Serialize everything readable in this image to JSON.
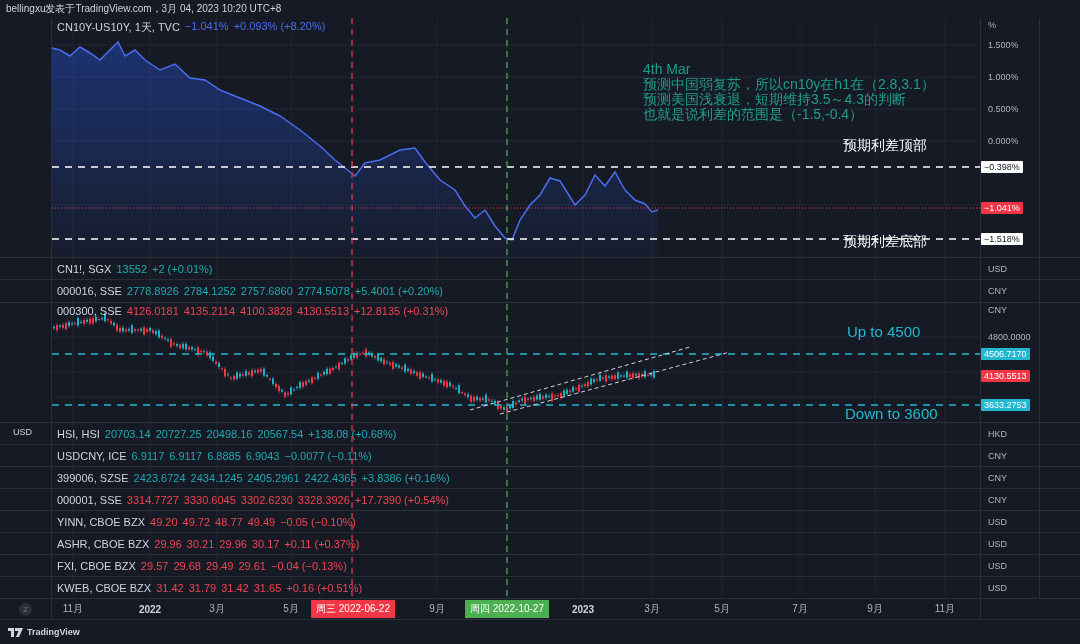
{
  "header": {
    "text": "bellingxu发表于TradingView.com，3月 04, 2023 10:20 UTC+8"
  },
  "panes": [
    {
      "kind": "line",
      "symbol": "CN10Y-US10Y, 1天, TVC",
      "values": [
        "−1.041%",
        "+0.093% (+8.20%)"
      ],
      "color": "#4a6cf0",
      "unit": "%",
      "ticks": [
        "1.500%",
        "1.000%",
        "0.500%",
        "0.000%"
      ],
      "tags": [
        {
          "text": "−0.398%",
          "color": "#ffffff"
        },
        {
          "text": "−1.041%",
          "color": "#f23645"
        },
        {
          "text": "−1.518%",
          "color": "#ffffff"
        }
      ],
      "annotations": [
        {
          "lines": [
            "4th Mar",
            "预测中国弱复苏，所以cn10y在h1在（2.8,3.1）",
            "预测美国浅衰退，短期维持3.5～4.3的判断",
            "也就是说利差的范围是（-1.5,-0.4）"
          ],
          "color": "#1e9e8a"
        },
        {
          "lines": [
            "预期利差顶部"
          ],
          "color": "#ffffff"
        },
        {
          "lines": [
            "预期利差底部"
          ],
          "color": "#ffffff"
        }
      ]
    },
    {
      "kind": "row",
      "symbol": "CN1!, SGX",
      "values": [
        "13552",
        "+2 (+0.01%)"
      ],
      "color": "#1fa9b0",
      "unit": "USD"
    },
    {
      "kind": "row",
      "symbol": "000016, SSE",
      "values": [
        "2778.8926",
        "2784.1252",
        "2757.6860",
        "2774.5078",
        "+5.4001 (+0.20%)"
      ],
      "color": "#1fa9b0",
      "unit": "CNY"
    },
    {
      "kind": "candles",
      "symbol": "000300, SSE",
      "values": [
        "4126.0181",
        "4135.2114",
        "4100.3828",
        "4130.5513",
        "+12.8135 (+0.31%)"
      ],
      "color": "#f0444f",
      "unit": "CNY",
      "ticks": [
        "4800.0000"
      ],
      "tags": [
        {
          "text": "4506.7170",
          "color": "#22b8d0"
        },
        {
          "text": "4130.5513",
          "color": "#f23645"
        },
        {
          "text": "3633.2753",
          "color": "#22b8d0"
        }
      ],
      "annotations": [
        {
          "lines": [
            "Up to 4500"
          ],
          "color": "#22b8d0"
        },
        {
          "lines": [
            "Down to 3600"
          ],
          "color": "#22b8d0"
        }
      ]
    },
    {
      "kind": "row",
      "left_label": "USD",
      "symbol": "HSI, HSI",
      "values": [
        "20703.14",
        "20727.25",
        "20498.16",
        "20567.54",
        "+138.08 (+0.68%)"
      ],
      "color": "#1fa9b0",
      "unit": "HKD"
    },
    {
      "kind": "row",
      "symbol": "USDCNY, ICE",
      "values": [
        "6.9117",
        "6.9117",
        "6.8885",
        "6.9043",
        "−0.0077 (−0.11%)"
      ],
      "color": "#1fa9b0",
      "unit": "CNY"
    },
    {
      "kind": "row",
      "symbol": "399006, SZSE",
      "values": [
        "2423.6724",
        "2434.1245",
        "2405.2961",
        "2422.4365",
        "+3.8386 (+0.16%)"
      ],
      "color": "#1fa9b0",
      "unit": "CNY"
    },
    {
      "kind": "row",
      "symbol": "000001, SSE",
      "values": [
        "3314.7727",
        "3330.6045",
        "3302.6230",
        "3328.3926",
        "+17.7390 (+0.54%)"
      ],
      "color": "#f0444f",
      "unit": "CNY"
    },
    {
      "kind": "row",
      "symbol": "YINN, CBOE BZX",
      "values": [
        "49.20",
        "49.72",
        "48.77",
        "49.49",
        "−0.05 (−0.10%)"
      ],
      "color": "#f0444f",
      "unit": "USD"
    },
    {
      "kind": "row",
      "symbol": "ASHR, CBOE BZX",
      "values": [
        "29.96",
        "30.21",
        "29.96",
        "30.17",
        "+0.11 (+0.37%)"
      ],
      "color": "#f0444f",
      "unit": "USD"
    },
    {
      "kind": "row",
      "symbol": "FXI, CBOE BZX",
      "values": [
        "29.57",
        "29.68",
        "29.49",
        "29.61",
        "−0.04 (−0.13%)"
      ],
      "color": "#f0444f",
      "unit": "USD"
    },
    {
      "kind": "row",
      "symbol": "KWEB, CBOE BZX",
      "values": [
        "31.42",
        "31.79",
        "31.42",
        "31.65",
        "+0.16 (+0.51%)"
      ],
      "color": "#f0444f",
      "unit": "USD"
    }
  ],
  "time_axis": {
    "zoom_label": "Z",
    "labels": [
      {
        "text": "11月",
        "kind": "month"
      },
      {
        "text": "2022",
        "kind": "year"
      },
      {
        "text": "3月",
        "kind": "month"
      },
      {
        "text": "5月",
        "kind": "month"
      },
      {
        "text": "周三 2022-06-22",
        "kind": "marker",
        "color": "#f23645"
      },
      {
        "text": "9月",
        "kind": "month"
      },
      {
        "text": "周四 2022-10-27",
        "kind": "marker",
        "color": "#4caf50"
      },
      {
        "text": "2023",
        "kind": "year"
      },
      {
        "text": "3月",
        "kind": "month"
      },
      {
        "text": "5月",
        "kind": "month"
      },
      {
        "text": "7月",
        "kind": "month"
      },
      {
        "text": "9月",
        "kind": "month"
      },
      {
        "text": "11月",
        "kind": "month"
      }
    ]
  },
  "footer": {
    "brand": "TradingView"
  }
}
